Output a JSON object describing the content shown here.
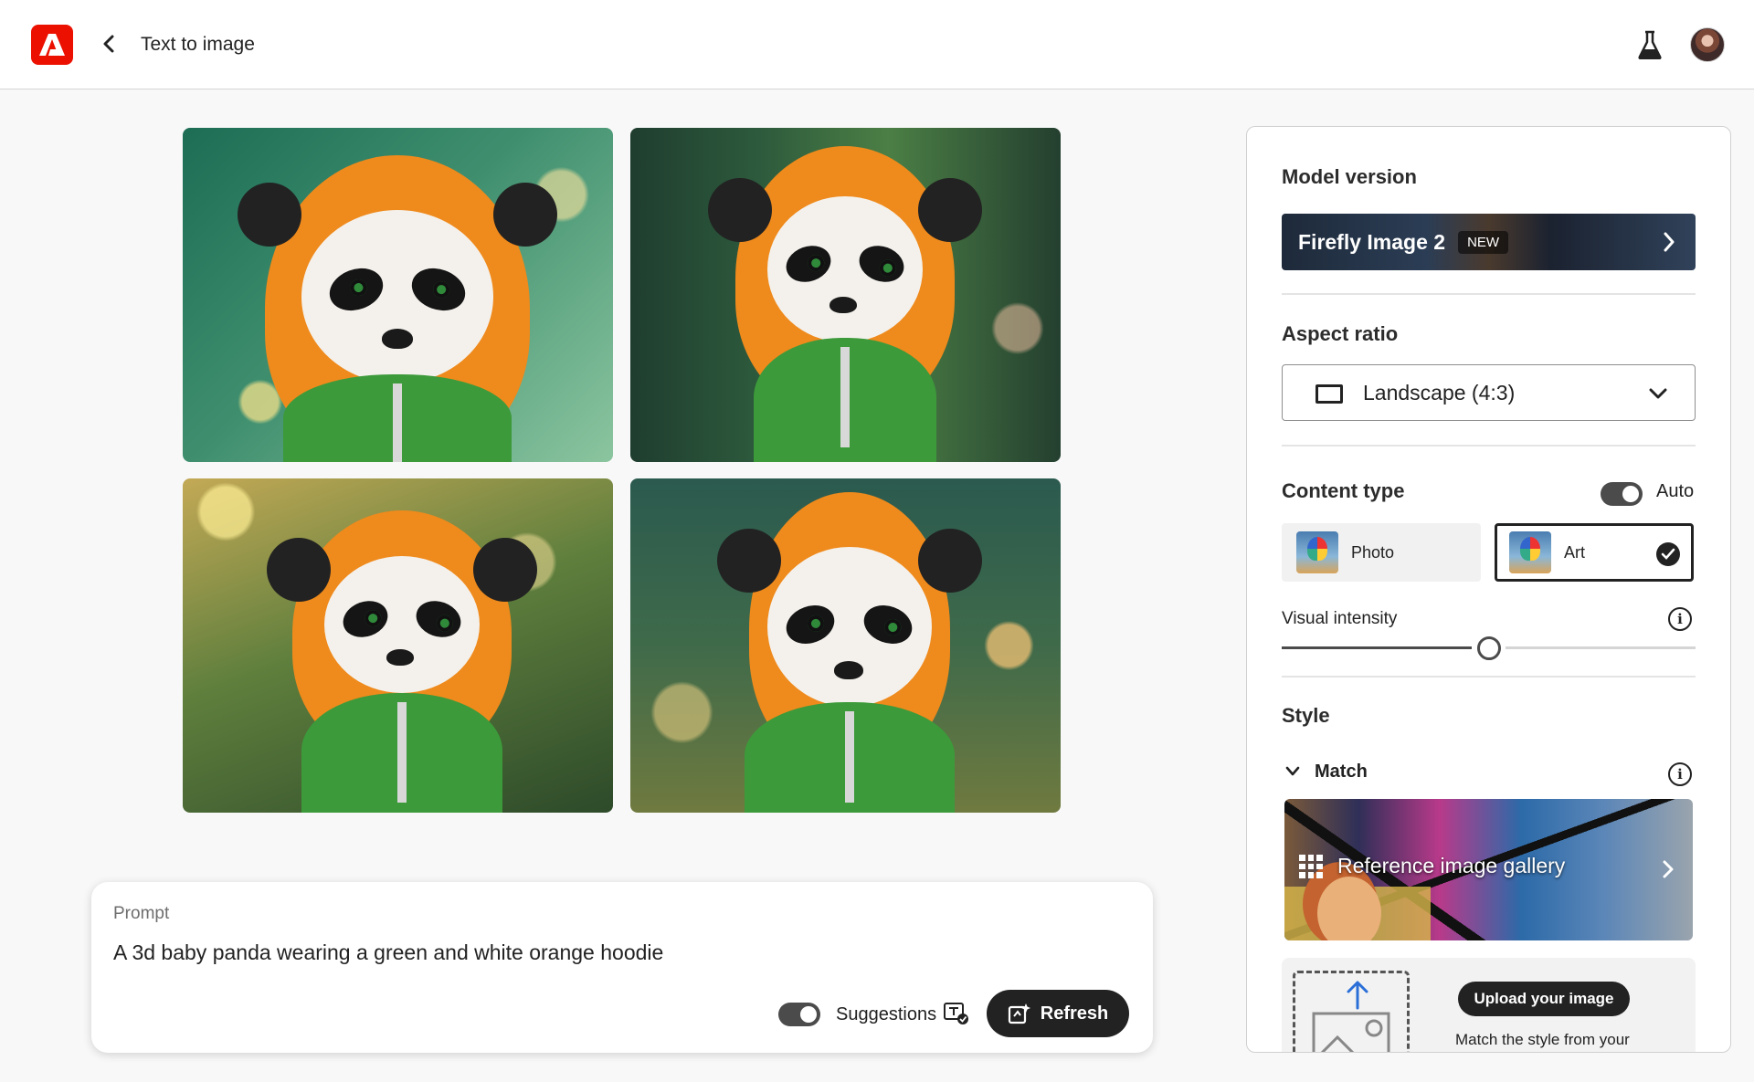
{
  "header": {
    "app_name": "Adobe",
    "title": "Text to image"
  },
  "images": [
    {
      "name": "panda-image-1"
    },
    {
      "name": "panda-image-2"
    },
    {
      "name": "panda-image-3"
    },
    {
      "name": "panda-image-4"
    }
  ],
  "prompt": {
    "label": "Prompt",
    "text": "A 3d baby panda wearing a green and white orange hoodie",
    "suggestions_label": "Suggestions",
    "suggestions_on": true,
    "refresh_label": "Refresh"
  },
  "panel": {
    "model_version": {
      "heading": "Model version",
      "name": "Firefly Image 2",
      "badge": "NEW"
    },
    "aspect_ratio": {
      "heading": "Aspect ratio",
      "selected": "Landscape (4:3)"
    },
    "content_type": {
      "heading": "Content type",
      "auto_label": "Auto",
      "auto_on": true,
      "options": [
        {
          "label": "Photo",
          "selected": false
        },
        {
          "label": "Art",
          "selected": true
        }
      ]
    },
    "visual_intensity": {
      "label": "Visual intensity",
      "info_glyph": "i",
      "value_fraction": 0.5
    },
    "style": {
      "heading": "Style",
      "match_label": "Match",
      "info_glyph": "i",
      "gallery_label": "Reference image gallery",
      "upload_label": "Upload your image",
      "upload_desc": "Match the style from your"
    }
  },
  "colors": {
    "brand": "#eb1000",
    "dark": "#222222",
    "hood": "#ef8a1c",
    "hoodie": "#3c9a3a"
  }
}
